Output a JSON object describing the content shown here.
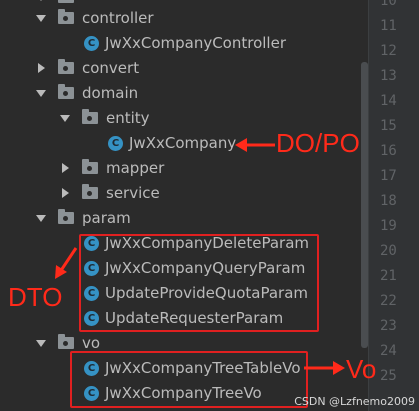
{
  "tree": {
    "controller_folder": "controller",
    "controller_class": "JwXxCompanyController",
    "convert_folder": "convert",
    "domain_folder": "domain",
    "entity_folder": "entity",
    "entity_class": "JwXxCompany",
    "mapper_folder": "mapper",
    "service_folder": "service",
    "param_folder": "param",
    "param_classes": [
      "JwXxCompanyDeleteParam",
      "JwXxCompanyQueryParam",
      "UpdateProvideQuotaParam",
      "UpdateRequesterParam"
    ],
    "vo_folder": "vo",
    "vo_classes": [
      "JwXxCompanyTreeTableVo",
      "JwXxCompanyTreeVo"
    ],
    "class_badge": "C"
  },
  "line_numbers": [
    "10",
    "11",
    "12",
    "13",
    "14",
    "15",
    "16",
    "17",
    "18",
    "19",
    "20",
    "21",
    "22",
    "23",
    "24",
    "25"
  ],
  "annotations": {
    "do_po": "DO/PO",
    "dto": "DTO",
    "vo": "Vo",
    "color": "#ff2a1a"
  },
  "watermark": "CSDN @Lzfnemo2009",
  "colors": {
    "background": "#2b2b2b",
    "gutter": "#313335",
    "class_icon": "#3592c4",
    "folder_icon": "#8c9296"
  }
}
